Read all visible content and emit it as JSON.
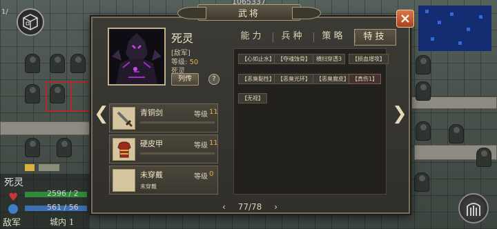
{
  "hud": {
    "top_counter": "1065337",
    "corner_tag": "1/",
    "unit_name": "死灵",
    "hp_text": "2596 / 2",
    "mp_text": "561 / 56",
    "faction": "敌军",
    "city": "城内 1"
  },
  "dialog": {
    "title": "武将",
    "general": {
      "name": "死灵",
      "faction_tag": "[敌军]",
      "level_label": "等级:",
      "level_value": "50",
      "type": "死灵",
      "bio_button": "列传",
      "help_button": "?"
    },
    "equipment": [
      {
        "name": "青铜剑",
        "level_label": "等级",
        "level": "11",
        "sub": "",
        "icon": "sword-icon"
      },
      {
        "name": "硬皮甲",
        "level_label": "等级",
        "level": "11",
        "sub": "",
        "icon": "armor-icon"
      },
      {
        "name": "未穿戴",
        "level_label": "等级",
        "level": "0",
        "sub": "未穿戴",
        "icon": "empty-slot-icon"
      }
    ],
    "tabs": [
      {
        "label": "能力",
        "active": false
      },
      {
        "label": "兵种",
        "active": false
      },
      {
        "label": "策略",
        "active": false
      },
      {
        "label": "特技",
        "active": true
      }
    ],
    "skills": [
      "【心如止水】",
      "【夺魂蚀骨】",
      "横扫穿透3",
      "【损血增攻】",
      "【恶臭黏性】",
      "【恶臭光环】",
      "【恶臭腐皮】",
      "【真伤1】",
      "【无视】"
    ],
    "pager": {
      "text": "77/78",
      "prev": "‹",
      "next": "›"
    },
    "nav": {
      "left": "❮",
      "right": "❯"
    }
  },
  "colors": {
    "accent_gold": "#e1b14b",
    "panel_border": "#78705a",
    "close_button": "#c85a34"
  }
}
